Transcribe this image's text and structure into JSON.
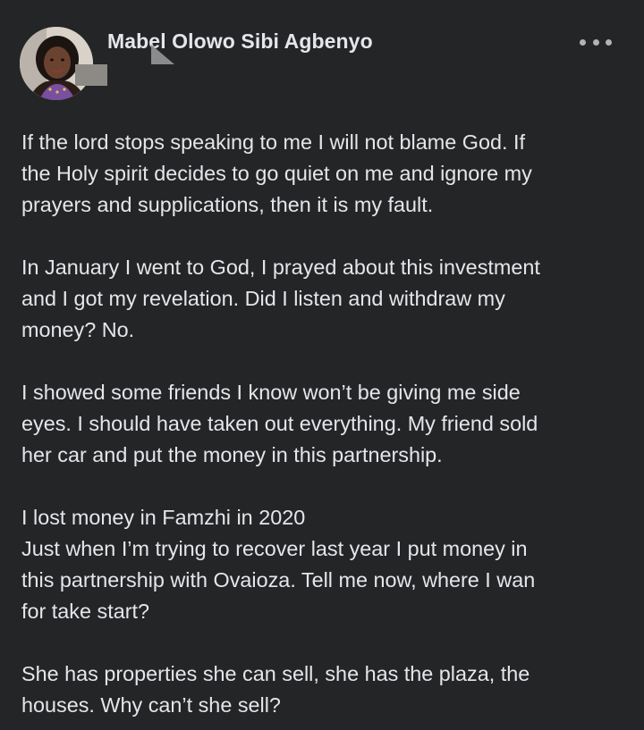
{
  "post": {
    "author_name": "Mabel Olowo Sibi Agbenyo",
    "avatar_icon": "profile-photo",
    "more_icon": "more-options-icon",
    "paragraphs": [
      "If the lord stops speaking to me I will not blame God. If\nthe Holy spirit decides to go quiet on me and ignore my\nprayers and supplications, then it is my fault.",
      "In January I went to God, I prayed about this investment\nand I got my revelation. Did I listen and withdraw my\nmoney? No.",
      "I showed some friends I know won’t be giving me side\neyes. I should have taken out everything. My friend sold\nher car and put the money in this partnership.",
      "I lost money in Famzhi in 2020\nJust when I’m trying to recover last year I put money in\nthis partnership with Ovaioza. Tell me now, where I wan\nfor take start?",
      "She has properties she can sell, she has the plaza, the\nhouses. Why can’t she sell?"
    ]
  },
  "colors": {
    "background": "#242526",
    "text": "#e4e6eb",
    "icon": "#b0b3b8"
  }
}
